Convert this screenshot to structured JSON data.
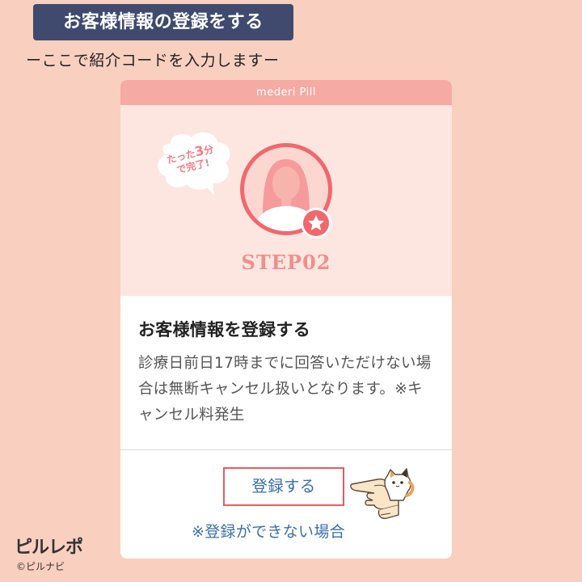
{
  "header": {
    "title": "お客様情報の登録をする",
    "subtitle": "ーここで紹介コードを入力しますー"
  },
  "app": {
    "bar_title": "mederi Pill",
    "bubble_line1": "たった",
    "bubble_number": "3",
    "bubble_unit": "分",
    "bubble_line2": "で完了!",
    "avatar_icon": "woman-avatar-icon",
    "badge_icon": "star-icon",
    "step": "STEP02",
    "info_title": "お客様情報を登録する",
    "info_desc": "診療日前日17時までに回答いただけない場合は無断キャンセル扱いとなります。※キャンセル料発生",
    "register_label": "登録する",
    "cant_register_label": "※登録ができない場合"
  },
  "footer": {
    "logo_text": "ピルレポ",
    "copyright": "©ピルナビ"
  },
  "colors": {
    "background": "#f9cfbf",
    "header_bg": "#3f4a6e",
    "app_bar": "#f5aaa4",
    "hero_bg": "#fde6e0",
    "accent_red": "#e85b5f",
    "link_blue": "#3a6ea8",
    "step_pink": "#f08f8c"
  }
}
